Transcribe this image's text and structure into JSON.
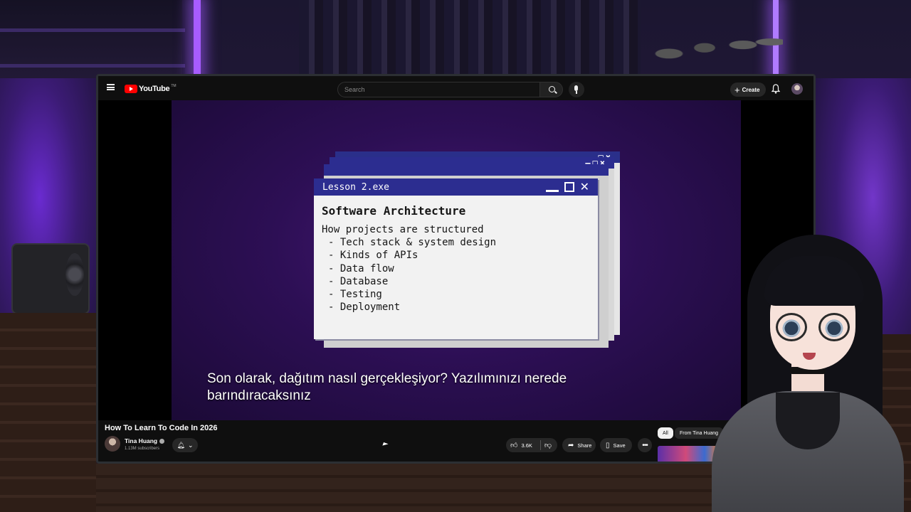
{
  "header": {
    "logo_text": "YouTube",
    "logo_tm": "TM",
    "search_placeholder": "Search",
    "create_label": "Create",
    "icons": [
      "menu-icon",
      "search-icon",
      "mic-icon",
      "bell-icon",
      "avatar"
    ]
  },
  "lesson": {
    "window_title": "Lesson 2.exe",
    "heading": "Software Architecture",
    "subheading": "How projects are structured",
    "items": [
      "- Tech stack & system design",
      "- Kinds of APIs",
      "- Data flow",
      "- Database",
      "- Testing",
      "- Deployment"
    ]
  },
  "captions": {
    "line1": "Son olarak, dağıtım nasıl gerçekleşiyor?  Yazılımınızı nerede",
    "line2": "barındıracaksınız"
  },
  "video": {
    "title": "How To Learn To Code In 2026",
    "channel": "Tina Huang",
    "subscribers": "1.13M subscribers",
    "likes": "3.6K",
    "share_label": "Share",
    "save_label": "Save"
  },
  "chips": {
    "all": "All",
    "from": "From Tina Huang"
  },
  "colors": {
    "youtube_red": "#ff0000",
    "lesson_titlebar": "#2c2d90",
    "video_bg": "#2d0f55"
  }
}
